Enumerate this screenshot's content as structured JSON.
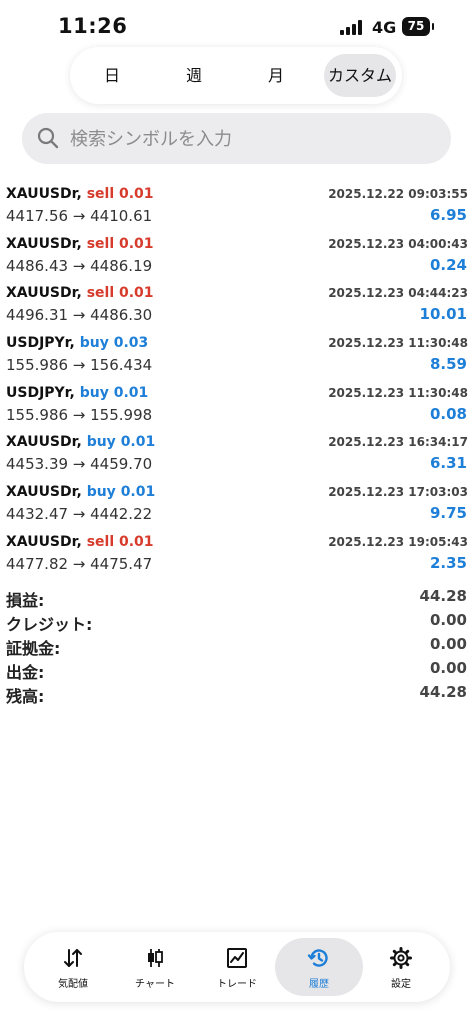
{
  "status_bar": {
    "time": "11:26",
    "network": "4G",
    "battery": "75"
  },
  "period_tabs": [
    "日",
    "週",
    "月",
    "カスタム"
  ],
  "active_period": "カスタム",
  "search": {
    "placeholder": "検索シンボルを入力"
  },
  "trades": [
    {
      "symbol": "XAUUSDr,",
      "side": "sell",
      "volume": "0.01",
      "datetime": "2025.12.22 09:03:55",
      "prices": "4417.56 → 4410.61",
      "profit": "6.95"
    },
    {
      "symbol": "XAUUSDr,",
      "side": "sell",
      "volume": "0.01",
      "datetime": "2025.12.23 04:00:43",
      "prices": "4486.43 → 4486.19",
      "profit": "0.24"
    },
    {
      "symbol": "XAUUSDr,",
      "side": "sell",
      "volume": "0.01",
      "datetime": "2025.12.23 04:44:23",
      "prices": "4496.31 → 4486.30",
      "profit": "10.01"
    },
    {
      "symbol": "USDJPYr,",
      "side": "buy",
      "volume": "0.03",
      "datetime": "2025.12.23 11:30:48",
      "prices": "155.986 → 156.434",
      "profit": "8.59"
    },
    {
      "symbol": "USDJPYr,",
      "side": "buy",
      "volume": "0.01",
      "datetime": "2025.12.23 11:30:48",
      "prices": "155.986 → 155.998",
      "profit": "0.08"
    },
    {
      "symbol": "XAUUSDr,",
      "side": "buy",
      "volume": "0.01",
      "datetime": "2025.12.23 16:34:17",
      "prices": "4453.39 → 4459.70",
      "profit": "6.31"
    },
    {
      "symbol": "XAUUSDr,",
      "side": "buy",
      "volume": "0.01",
      "datetime": "2025.12.23 17:03:03",
      "prices": "4432.47 → 4442.22",
      "profit": "9.75"
    },
    {
      "symbol": "XAUUSDr,",
      "side": "sell",
      "volume": "0.01",
      "datetime": "2025.12.23 19:05:43",
      "prices": "4477.82 → 4475.47",
      "profit": "2.35"
    }
  ],
  "summary": [
    {
      "label": "損益:",
      "value": "44.28"
    },
    {
      "label": "クレジット:",
      "value": "0.00"
    },
    {
      "label": "証拠金:",
      "value": "0.00"
    },
    {
      "label": "出金:",
      "value": "0.00"
    },
    {
      "label": "残高:",
      "value": "44.28"
    }
  ],
  "tabbar": [
    {
      "label": "気配値",
      "icon": "quotes-arrows-icon"
    },
    {
      "label": "チャート",
      "icon": "candlestick-chart-icon"
    },
    {
      "label": "トレード",
      "icon": "trade-line-chart-icon"
    },
    {
      "label": "履歴",
      "icon": "history-clock-icon"
    },
    {
      "label": "設定",
      "icon": "gear-icon"
    }
  ],
  "active_tab": "履歴",
  "colors": {
    "sell": "#d63b2c",
    "buy": "#1e7fd8",
    "profit": "#1e7fd8",
    "active_bg": "#e6e6e8"
  }
}
